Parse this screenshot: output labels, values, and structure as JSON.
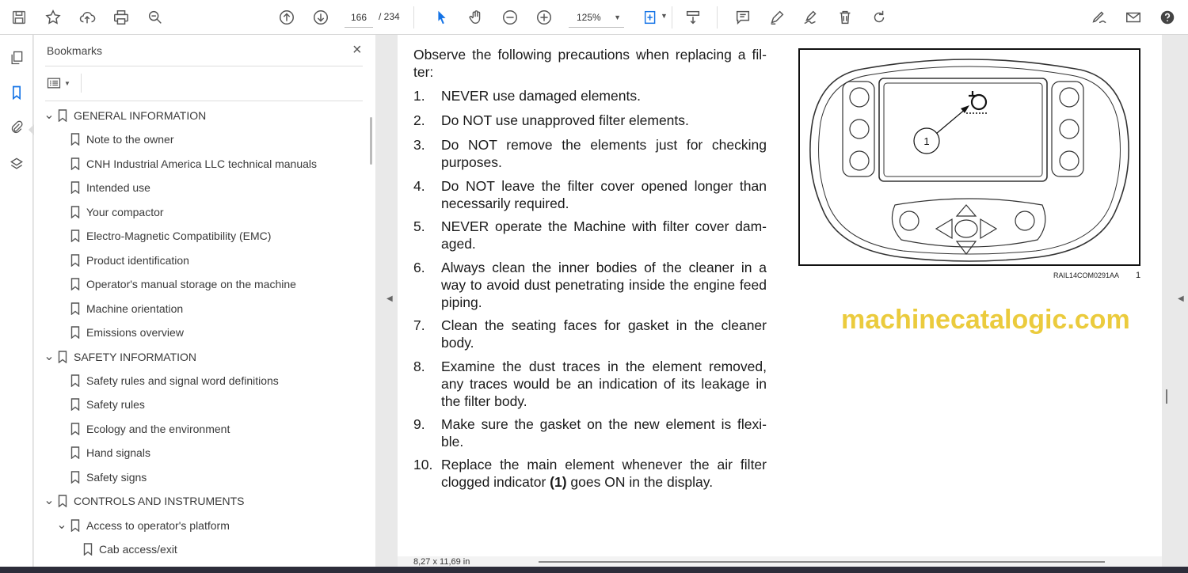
{
  "toolbar": {
    "page_current": "166",
    "page_total": "/ 234",
    "zoom": "125%",
    "icons": [
      "save-icon",
      "star-icon",
      "upload-icon",
      "print-icon",
      "zoom-search-icon",
      "page-up-icon",
      "page-down-icon",
      "select-cursor-icon",
      "hand-icon",
      "zoom-out-icon",
      "zoom-in-icon",
      "fit-page-icon",
      "scroll-mode-icon",
      "comment-icon",
      "pen-icon",
      "sign-icon",
      "delete-icon",
      "redo-icon",
      "fill-sign-icon",
      "mail-icon",
      "help-icon"
    ]
  },
  "sidebar": {
    "title": "Bookmarks",
    "close": "×",
    "items": [
      {
        "label": "GENERAL INFORMATION",
        "level": 0,
        "expanded": true
      },
      {
        "label": "Note to the owner",
        "level": 1
      },
      {
        "label": "CNH Industrial America LLC technical manuals",
        "level": 1
      },
      {
        "label": "Intended use",
        "level": 1
      },
      {
        "label": "Your compactor",
        "level": 1
      },
      {
        "label": "Electro-Magnetic Compatibility (EMC)",
        "level": 1
      },
      {
        "label": "Product identification",
        "level": 1
      },
      {
        "label": "Operator's manual storage on the machine",
        "level": 1
      },
      {
        "label": "Machine orientation",
        "level": 1
      },
      {
        "label": "Emissions overview",
        "level": 1
      },
      {
        "label": "SAFETY INFORMATION",
        "level": 0,
        "expanded": true
      },
      {
        "label": "Safety rules and signal word definitions",
        "level": 1
      },
      {
        "label": "Safety rules",
        "level": 1
      },
      {
        "label": "Ecology and the environment",
        "level": 1
      },
      {
        "label": "Hand signals",
        "level": 1
      },
      {
        "label": "Safety signs",
        "level": 1
      },
      {
        "label": "CONTROLS AND INSTRUMENTS",
        "level": 0,
        "expanded": true
      },
      {
        "label": "Access to operator's platform",
        "level": 1,
        "expanded": true
      },
      {
        "label": "Cab access/exit",
        "level": 2
      }
    ]
  },
  "document": {
    "intro": "Observe the following precautions when replacing a fil-ter:",
    "items": [
      {
        "num": "1.",
        "text": "NEVER use damaged elements."
      },
      {
        "num": "2.",
        "text": "Do NOT use unapproved filter elements."
      },
      {
        "num": "3.",
        "text": "Do NOT remove the elements just for checking purposes."
      },
      {
        "num": "4.",
        "text": "Do NOT leave the filter cover opened longer than necessarily required."
      },
      {
        "num": "5.",
        "text": "NEVER operate the Machine with filter cover dam-aged."
      },
      {
        "num": "6.",
        "text": "Always clean the inner bodies of the cleaner in a way to avoid dust penetrating inside the engine feed piping."
      },
      {
        "num": "7.",
        "text": "Clean the seating faces for gasket in the cleaner body."
      },
      {
        "num": "8.",
        "text": "Examine the dust traces in the element removed, any traces would be an indication of its leakage in the filter body."
      },
      {
        "num": "9.",
        "text": "Make sure the gasket on the new element is flexi-ble."
      },
      {
        "num": "10.",
        "text_before": "Replace the main element whenever the air filter clogged indicator ",
        "text_bold": "(1)",
        "text_after": " goes ON in the display."
      }
    ],
    "figure_callout": "1",
    "figure_caption": "RAIL14COM0291AA",
    "figure_number": "1",
    "watermark": "machinecatalogic.com",
    "page_size": "8,27 x 11,69 in"
  }
}
